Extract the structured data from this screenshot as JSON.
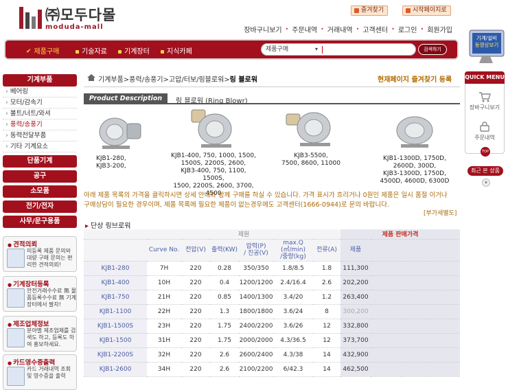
{
  "header": {
    "logo_korean": "㈜모두다몰",
    "logo_english": "moduda-mall",
    "bookmark_btn": "즐겨찾기",
    "homepage_btn": "시작페이지로",
    "top_links": [
      "장바구니보기",
      "주문내역",
      "거래내역",
      "고객센터",
      "로그인",
      "회원가입"
    ]
  },
  "nav": {
    "items": [
      "제품구매",
      "기술자료",
      "기계장터",
      "지식카페"
    ],
    "search_select": "제품구매",
    "search_button": "검색하기"
  },
  "side_banner": {
    "line1": "기계/설비",
    "line2": "동영상보기"
  },
  "sidebar": {
    "head": "기계부품",
    "subs": [
      "베어링",
      "모터/감속기",
      "볼트/너트/와셔",
      "풍력/송풍기",
      "동력전달부품",
      "기타 기계요소"
    ],
    "cats": [
      "단품기계",
      "공구",
      "소모품",
      "전기/전자",
      "사무/문구용품"
    ]
  },
  "promos": [
    {
      "title": "견적의뢰",
      "desc": "미등록 제품 문의와 대량 구매 문의는 편리한 견적의뢰!"
    },
    {
      "title": "기계장터등록",
      "desc": "안전거래수수료 無 물품등록수수료 無 기계장터에서 팔자!"
    },
    {
      "title": "제조업체정보",
      "desc": "분야별 제조업체를 검색도 하고, 등록도 하여 홍보하세요."
    },
    {
      "title": "카드영수증출력",
      "desc": "카드 거래내역 조회 및 영수증을 출력"
    }
  ],
  "breadcrumb": {
    "path": "기계부품>풍력/송풍기>고압/터보/링블로워>",
    "current": "링 블로워"
  },
  "favorite_text": "현재페이지 즐겨찾기 등록",
  "tab": {
    "label": "Product Description",
    "name": "링 블로워 (Ring Blowr)"
  },
  "products": [
    {
      "caption": "KJB1-280,\nKJB3-200,"
    },
    {
      "caption": "KJB1-400, 750, 1000, 1500,\n1500S, 2200S, 2600,\nKJB3-400, 750, 1100, 1500S,\n1500, 2200S, 2600, 3700, 4500"
    },
    {
      "caption": "KJB3-5500,\n7500, 8600, 11000"
    },
    {
      "caption": "KJB1-1300D, 1750D,\n2600D, 300D,\nKJB3-1300D, 1750D,\n4500D, 4600D, 6300D"
    }
  ],
  "notice": "아래 제품 목록의 가격을 클릭하시면 상세 안내와 함께 구매를 하실 수 있습니다. 가격 표시가 흐리거나 0원인 제품은 일시 품절 이거나 구매상담이 필요한 경우이며, 제품 목록에 필요한 제품이 없는경우에도 고객센터(1666-0944)로 문의 바랍니다.",
  "more_link": "[부가세별도]",
  "section_title": "단상 링브로워",
  "table": {
    "spec_header": "제원",
    "price_header": "제품 판매가격",
    "columns": [
      "Curve No.",
      "전압(V)",
      "출력(KW)",
      "압력(P)\n/ 진공(V)",
      "max.Q\n(㎥/min)\n/중량(kg)",
      "전류(A)",
      "제품"
    ],
    "rows": [
      {
        "model": "KJB1-280",
        "curve": "7H",
        "volt": "220",
        "kw": "0.28",
        "press": "350/350",
        "q": "1.8/8.5",
        "amp": "1.8",
        "price": "111,300",
        "muted": false
      },
      {
        "model": "KJB1-400",
        "curve": "10H",
        "volt": "220",
        "kw": "0.4",
        "press": "1200/1200",
        "q": "2.4/16.4",
        "amp": "2.6",
        "price": "202,200",
        "muted": false
      },
      {
        "model": "KJB1-750",
        "curve": "21H",
        "volt": "220",
        "kw": "0.85",
        "press": "1400/1300",
        "q": "3.4/20",
        "amp": "1.2",
        "price": "263,400",
        "muted": false
      },
      {
        "model": "KJB1-1100",
        "curve": "22H",
        "volt": "220",
        "kw": "1.3",
        "press": "1800/1800",
        "q": "3.6/24",
        "amp": "8",
        "price": "300,200",
        "muted": true
      },
      {
        "model": "KJB1-1500S",
        "curve": "23H",
        "volt": "220",
        "kw": "1.75",
        "press": "2400/2200",
        "q": "3.6/26",
        "amp": "12",
        "price": "332,800",
        "muted": false
      },
      {
        "model": "KJB1-1500",
        "curve": "31H",
        "volt": "220",
        "kw": "1.75",
        "press": "2000/2000",
        "q": "4.3/36.5",
        "amp": "12",
        "price": "373,700",
        "muted": false
      },
      {
        "model": "KJB1-2200S",
        "curve": "32H",
        "volt": "220",
        "kw": "2.6",
        "press": "2600/2400",
        "q": "4.3/38",
        "amp": "14",
        "price": "432,900",
        "muted": false
      },
      {
        "model": "KJB1-2600",
        "curve": "34H",
        "volt": "220",
        "kw": "2.6",
        "press": "2100/2200",
        "q": "6/42.3",
        "amp": "14",
        "price": "462,500",
        "muted": false
      }
    ]
  },
  "quick_menu": {
    "head": "QUICK MENU",
    "items": [
      "장바구니보기",
      "주문내역"
    ],
    "top": "TOP",
    "recent": "최근 본 상품"
  }
}
